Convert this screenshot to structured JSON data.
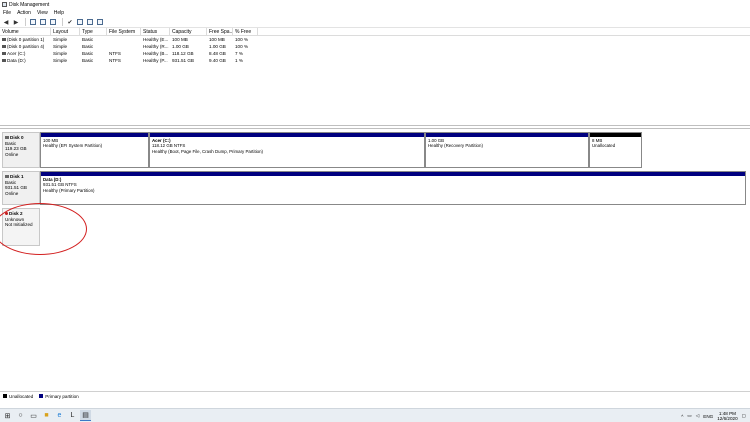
{
  "window": {
    "title": "Disk Management"
  },
  "menu": [
    "File",
    "Action",
    "View",
    "Help"
  ],
  "volume_table": {
    "headers": [
      "Volume",
      "Layout",
      "Type",
      "File System",
      "Status",
      "Capacity",
      "Free Spa...",
      "% Free"
    ],
    "rows": [
      [
        "(Disk 0 partition 1)",
        "Simple",
        "Basic",
        "",
        "Healthy (E...",
        "100 MB",
        "100 MB",
        "100 %"
      ],
      [
        "(Disk 0 partition 4)",
        "Simple",
        "Basic",
        "",
        "Healthy (R...",
        "1.00 GB",
        "1.00 GB",
        "100 %"
      ],
      [
        "Acer (C:)",
        "Simple",
        "Basic",
        "NTFS",
        "Healthy (B...",
        "118.12 GB",
        "8.48 GB",
        "7 %"
      ],
      [
        "Data (D:)",
        "Simple",
        "Basic",
        "NTFS",
        "Healthy (P...",
        "931.51 GB",
        "9.40 GB",
        "1 %"
      ]
    ]
  },
  "disks": [
    {
      "name": "Disk 0",
      "type": "Basic",
      "size": "119.23 GB",
      "status": "Online",
      "partitions": [
        {
          "name": "",
          "size": "100 MB",
          "status": "Healthy (EFI System Partition)"
        },
        {
          "name": "Acer  (C:)",
          "size": "118.12 GB NTFS",
          "status": "Healthy (Boot, Page File, Crash Dump, Primary Partition)"
        },
        {
          "name": "",
          "size": "1.00 GB",
          "status": "Healthy (Recovery Partition)"
        },
        {
          "name": "",
          "size": "8 MB",
          "status": "Unallocated"
        }
      ]
    },
    {
      "name": "Disk 1",
      "type": "Basic",
      "size": "931.51 GB",
      "status": "Online",
      "partitions": [
        {
          "name": "Data  (D:)",
          "size": "931.51 GB NTFS",
          "status": "Healthy (Primary Partition)"
        }
      ]
    },
    {
      "name": "Disk 2",
      "type": "Unknown",
      "size": "",
      "status": "Not Initialized",
      "partitions": []
    }
  ],
  "legend": [
    {
      "label": "Unallocated",
      "color": "#000000"
    },
    {
      "label": "Primary partition",
      "color": "#00007f"
    }
  ],
  "taskbar": {
    "icons": [
      "windows-start-icon",
      "search-icon",
      "task-view-icon",
      "file-explorer-icon",
      "edge-icon",
      "app-icon",
      "disk-management-icon"
    ],
    "tray_lang": "ENG",
    "time": "1:48 PM",
    "date": "12/6/2020"
  },
  "colors": {
    "primary_partition": "#00007f",
    "unallocated": "#000000",
    "annotation": "#d32020"
  }
}
